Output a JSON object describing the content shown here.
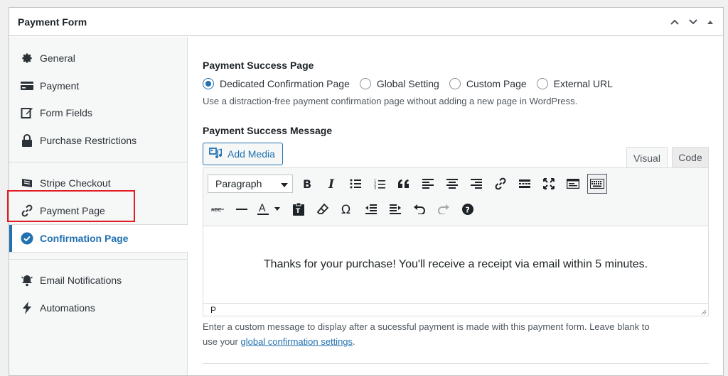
{
  "panel": {
    "title": "Payment Form"
  },
  "sidebar": {
    "items": [
      {
        "label": "General",
        "icon": "gear-icon"
      },
      {
        "label": "Payment",
        "icon": "credit-card-icon"
      },
      {
        "label": "Form Fields",
        "icon": "edit-icon"
      },
      {
        "label": "Purchase Restrictions",
        "icon": "lock-icon"
      },
      {
        "label": "Stripe Checkout",
        "icon": "stripe-icon"
      },
      {
        "label": "Payment Page",
        "icon": "link-icon"
      },
      {
        "label": "Confirmation Page",
        "icon": "check-circle-icon",
        "active": true
      },
      {
        "label": "Email Notifications",
        "icon": "bell-icon"
      },
      {
        "label": "Automations",
        "icon": "bolt-icon"
      }
    ]
  },
  "success_page": {
    "label": "Payment Success Page",
    "options": [
      "Dedicated Confirmation Page",
      "Global Setting",
      "Custom Page",
      "External URL"
    ],
    "selected": "Dedicated Confirmation Page",
    "description": "Use a distraction-free payment confirmation page without adding a new page in WordPress."
  },
  "success_message": {
    "label": "Payment Success Message",
    "add_media": "Add Media",
    "tabs": [
      "Visual",
      "Code"
    ],
    "format_select": "Paragraph",
    "editor_text": "Thanks for your purchase! You'll receive a receipt via email within 5 minutes.",
    "status_path": "P",
    "help_text": "Enter a custom message to display after a sucessful payment is made with this payment form. Leave blank to",
    "help_text_2": "use your",
    "help_link": "global confirmation settings",
    "help_end": "."
  },
  "colors": {
    "accent": "#2271b1",
    "highlight": "#e31b23"
  }
}
